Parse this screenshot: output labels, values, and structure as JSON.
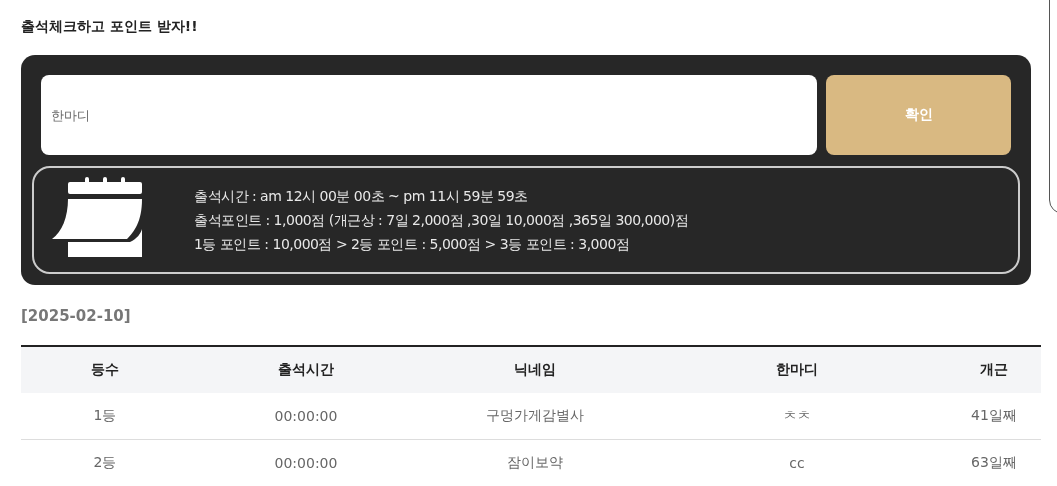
{
  "title": "출석체크하고 포인트 받자!!",
  "form": {
    "placeholder": "한마디",
    "button": "확인"
  },
  "info": [
    "출석시간 : am 12시 00분 00초 ~ pm 11시 59분 59초",
    "출석포인트 : 1,000점 (개근상 : 7일 2,000점 ,30일 10,000점 ,365일 300,000)점",
    "1등 포인트 : 10,000점 > 2등 포인트 : 5,000점 > 3등 포인트 : 3,000점"
  ],
  "date": "[2025-02-10]",
  "table": {
    "columns": [
      "등수",
      "출석시간",
      "닉네임",
      "한마디",
      "개근"
    ],
    "rows": [
      [
        "1등",
        "00:00:00",
        "구멍가게감별사",
        "ㅊㅊ",
        "41일째"
      ],
      [
        "2등",
        "00:00:00",
        "잠이보약",
        "cc",
        "63일째"
      ]
    ]
  }
}
